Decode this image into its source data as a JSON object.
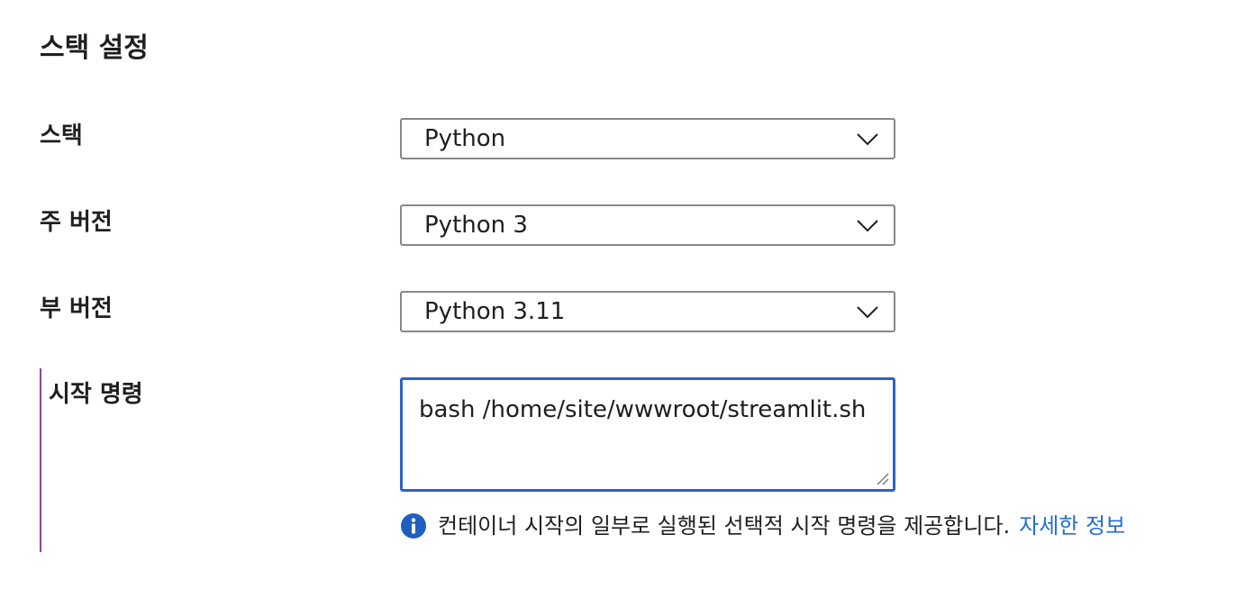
{
  "section": {
    "title": "스택 설정"
  },
  "fields": {
    "stack": {
      "label": "스택",
      "value": "Python"
    },
    "major_version": {
      "label": "주 버전",
      "value": "Python 3"
    },
    "minor_version": {
      "label": "부 버전",
      "value": "Python 3.11"
    },
    "startup_command": {
      "label": "시작 명령",
      "value": "bash /home/site/wwwroot/streamlit.sh"
    }
  },
  "info": {
    "text": "컨테이너 시작의 일부로 실행된 선택적 시작 명령을 제공합니다.",
    "link_label": "자세한 정보",
    "icon": "info-icon"
  },
  "colors": {
    "focus_border": "#2f62c7",
    "link": "#1f6fd1",
    "required_bar": "#8e44ad",
    "info_icon": "#1f5fbf"
  }
}
